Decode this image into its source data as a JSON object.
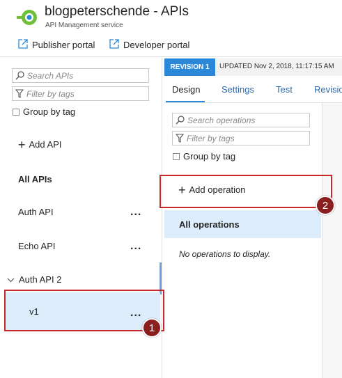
{
  "header": {
    "title": "blogpeterschende - APIs",
    "subtitle": "API Management service",
    "publisher_portal": "Publisher portal",
    "developer_portal": "Developer portal"
  },
  "left_panel": {
    "search_placeholder": "Search APIs",
    "filter_placeholder": "Filter by tags",
    "group_by_tag": "Group by tag",
    "add_api": "Add API",
    "all_apis": "All APIs",
    "apis": [
      {
        "name": "Auth API",
        "more": "..."
      },
      {
        "name": "Echo API",
        "more": "..."
      }
    ],
    "group": {
      "name": "Auth API 2",
      "expanded": true,
      "versions": [
        {
          "name": "v1",
          "more": "...",
          "selected": true
        }
      ]
    }
  },
  "revision": {
    "badge": "REVISION 1",
    "updated": "UPDATED Nov 2, 2018, 11:17:15 AM"
  },
  "tabs": [
    {
      "label": "Design",
      "active": true
    },
    {
      "label": "Settings"
    },
    {
      "label": "Test"
    },
    {
      "label": "Revisio"
    }
  ],
  "operations": {
    "search_placeholder": "Search operations",
    "filter_placeholder": "Filter by tags",
    "group_by_tag": "Group by tag",
    "add_operation": "Add operation",
    "all_operations": "All operations",
    "empty_message": "No operations to display."
  },
  "annotations": [
    "1",
    "2"
  ],
  "colors": {
    "accent": "#2b88d8",
    "selected_bg": "#dcecfa",
    "annotation": "#c8262a",
    "logo_green": "#6fbf3b"
  }
}
